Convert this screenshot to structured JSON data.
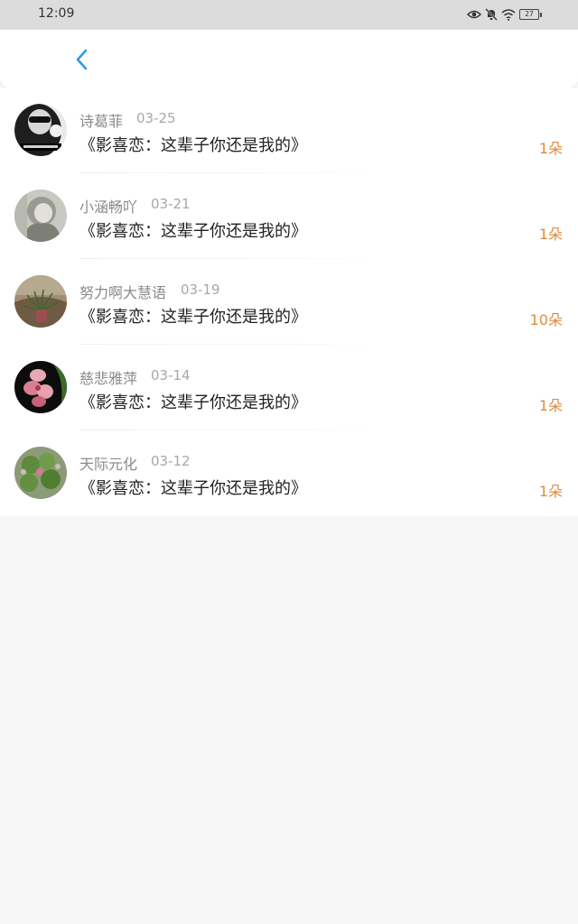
{
  "status_bar": {
    "time": "12:09",
    "battery": "27",
    "icons": [
      "eye-icon",
      "mute-bell-icon",
      "wifi-icon",
      "battery-icon"
    ]
  },
  "header": {
    "back_icon": "chevron-left-icon",
    "accent_color": "#2f9be8"
  },
  "gift_list": {
    "count_color": "#e28a3c",
    "items": [
      {
        "name": "诗葛菲",
        "date": "03-25",
        "title": "《影喜恋：这辈子你还是我的》",
        "count": "1朵"
      },
      {
        "name": "小涵畅吖",
        "date": "03-21",
        "title": "《影喜恋：这辈子你还是我的》",
        "count": "1朵"
      },
      {
        "name": "努力啊大慧语",
        "date": "03-19",
        "title": "《影喜恋：这辈子你还是我的》",
        "count": "10朵"
      },
      {
        "name": "慈悲雅萍",
        "date": "03-14",
        "title": "《影喜恋：这辈子你还是我的》",
        "count": "1朵"
      },
      {
        "name": "天际元化",
        "date": "03-12",
        "title": "《影喜恋：这辈子你还是我的》",
        "count": "1朵"
      }
    ]
  }
}
